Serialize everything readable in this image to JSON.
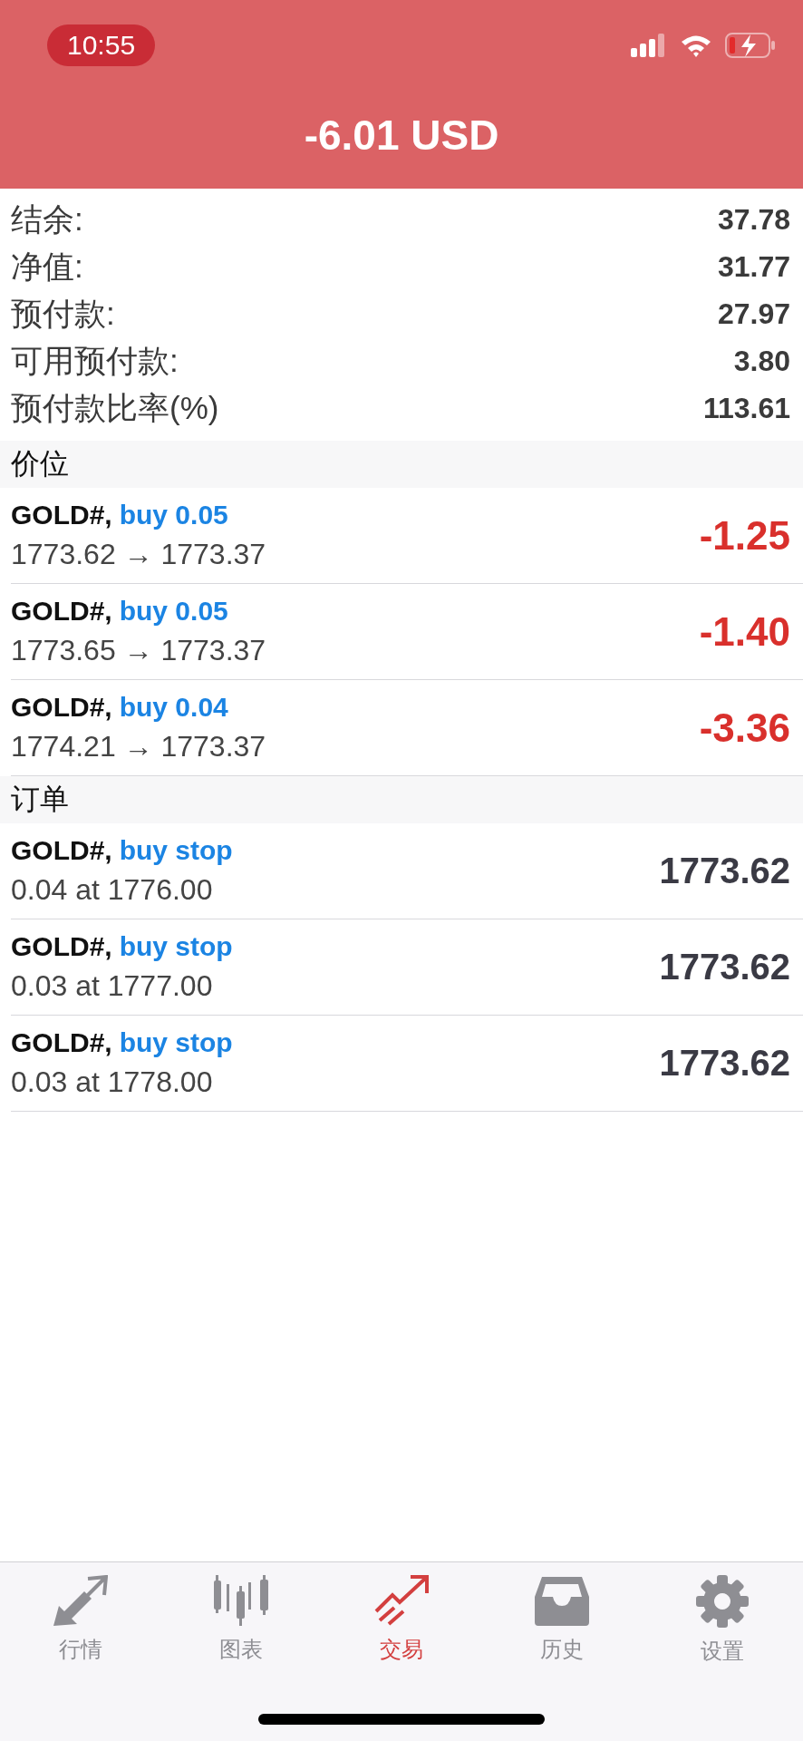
{
  "status_bar": {
    "time": "10:55"
  },
  "header": {
    "title": "-6.01 USD"
  },
  "summary": [
    {
      "label": "结余:",
      "value": "37.78"
    },
    {
      "label": "净值:",
      "value": "31.77"
    },
    {
      "label": "预付款:",
      "value": "27.97"
    },
    {
      "label": "可用预付款:",
      "value": "3.80"
    },
    {
      "label": "预付款比率(%)",
      "value": "113.61"
    }
  ],
  "positions": {
    "title": "价位",
    "rows": [
      {
        "symbol": "GOLD#,",
        "action": "buy 0.05",
        "detail": "1773.62 → 1773.37",
        "result": "-1.25"
      },
      {
        "symbol": "GOLD#,",
        "action": "buy 0.05",
        "detail": "1773.65 → 1773.37",
        "result": "-1.40"
      },
      {
        "symbol": "GOLD#,",
        "action": "buy 0.04",
        "detail": "1774.21 → 1773.37",
        "result": "-3.36"
      }
    ]
  },
  "orders": {
    "title": "订单",
    "rows": [
      {
        "symbol": "GOLD#,",
        "action": "buy stop",
        "detail": "0.04 at 1776.00",
        "result": "1773.62"
      },
      {
        "symbol": "GOLD#,",
        "action": "buy stop",
        "detail": "0.03 at 1777.00",
        "result": "1773.62"
      },
      {
        "symbol": "GOLD#,",
        "action": "buy stop",
        "detail": "0.03 at 1778.00",
        "result": "1773.62"
      }
    ]
  },
  "tabs": [
    {
      "kind": "quotes",
      "label": "行情",
      "selected": false
    },
    {
      "kind": "chart",
      "label": "图表",
      "selected": false
    },
    {
      "kind": "trade",
      "label": "交易",
      "selected": true
    },
    {
      "kind": "history",
      "label": "历史",
      "selected": false
    },
    {
      "kind": "settings",
      "label": "设置",
      "selected": false
    }
  ]
}
